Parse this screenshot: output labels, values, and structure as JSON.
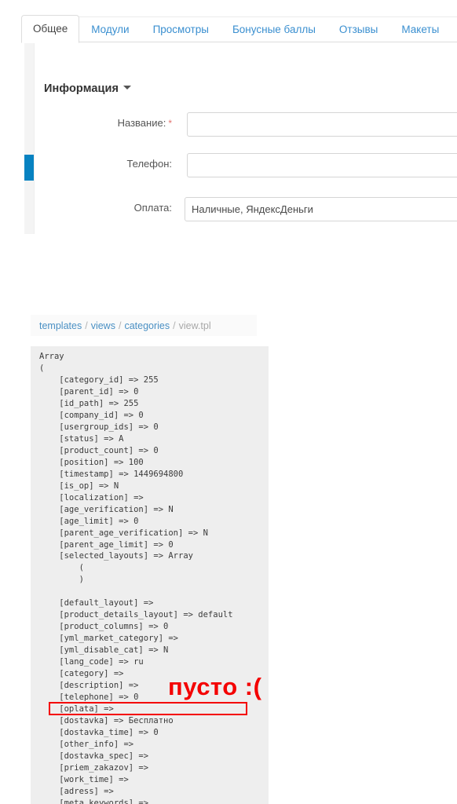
{
  "admin_panel": {
    "tabs": [
      {
        "label": "Общее",
        "active": true
      },
      {
        "label": "Модули",
        "active": false
      },
      {
        "label": "Просмотры",
        "active": false
      },
      {
        "label": "Бонусные баллы",
        "active": false
      },
      {
        "label": "Отзывы",
        "active": false
      },
      {
        "label": "Макеты",
        "active": false
      }
    ],
    "section": {
      "title": "Информация",
      "caret": "chevron-down-icon"
    },
    "fields": [
      {
        "label": "Название:",
        "required": true,
        "required_marker": "*",
        "value": "",
        "placeholder": ""
      },
      {
        "label": "Телефон:",
        "required": false,
        "required_marker": "",
        "value": "",
        "placeholder": ""
      },
      {
        "label": "Оплата:",
        "required": false,
        "required_marker": "",
        "value": "Наличные, ЯндексДеньги",
        "placeholder": ""
      }
    ],
    "scrollbar": {
      "thumb_color": "#0782c1",
      "track_color": "#f4f4f4"
    }
  },
  "breadcrumb": {
    "parts": [
      {
        "text": "templates",
        "link": true
      },
      {
        "text": "views",
        "link": true
      },
      {
        "text": "categories",
        "link": true
      },
      {
        "text": "view.tpl",
        "link": false
      }
    ],
    "separator": "/"
  },
  "code_dump": {
    "text": "Array\n(\n    [category_id] => 255\n    [parent_id] => 0\n    [id_path] => 255\n    [company_id] => 0\n    [usergroup_ids] => 0\n    [status] => A\n    [product_count] => 0\n    [position] => 100\n    [timestamp] => 1449694800\n    [is_op] => N\n    [localization] => \n    [age_verification] => N\n    [age_limit] => 0\n    [parent_age_verification] => N\n    [parent_age_limit] => 0\n    [selected_layouts] => Array\n        (\n        )\n\n    [default_layout] => \n    [product_details_layout] => default\n    [product_columns] => 0\n    [yml_market_category] => \n    [yml_disable_cat] => N\n    [lang_code] => ru\n    [category] => \n    [description] => \n    [telephone] => 0\n    [oplata] => \n    [dostavka] => Бесплатно\n    [dostavka_time] => 0\n    [other_info] => \n    [dostavka_spec] => \n    [priem_zakazov] => \n    [work_time] => \n    [adress] => \n    [meta_keywords] => "
  },
  "annotation": {
    "text": "пусто :(",
    "color": "#f40000",
    "highlighted_key": "[oplata] =>"
  }
}
